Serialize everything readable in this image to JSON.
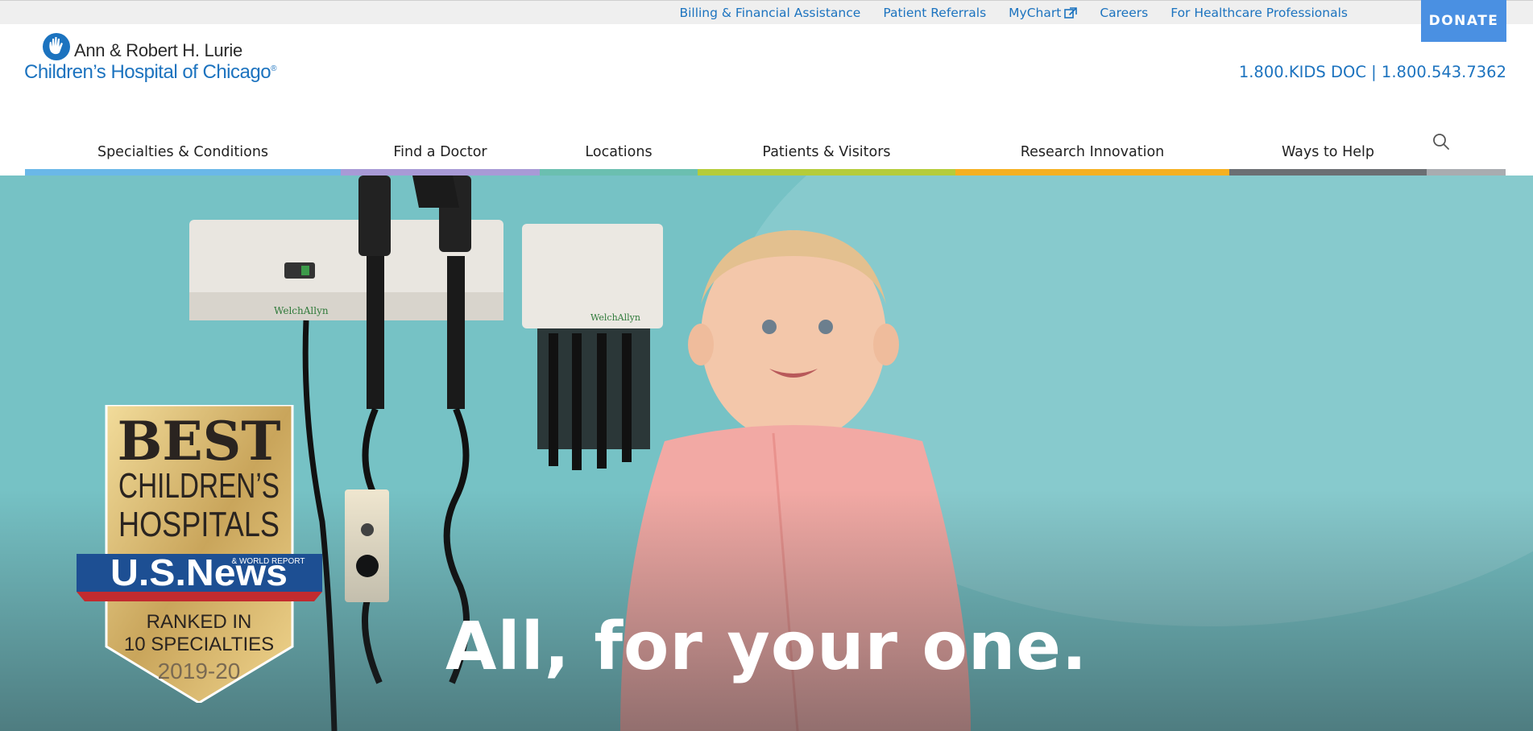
{
  "utility_nav": {
    "links": [
      {
        "label": "Billing & Financial Assistance"
      },
      {
        "label": "Patient Referrals"
      },
      {
        "label": "MyChart",
        "icon": "external-link-icon"
      },
      {
        "label": "Careers"
      },
      {
        "label": "For Healthcare Professionals"
      }
    ],
    "donate_label": "DONATE"
  },
  "logo": {
    "line1": "Ann & Robert H. Lurie",
    "line2": "Children’s Hospital of Chicago",
    "registered_mark": "®",
    "icon": "hand-heart-icon"
  },
  "header": {
    "phone": "1.800.KIDS DOC | 1.800.543.7362"
  },
  "main_nav": {
    "items": [
      {
        "label": "Specialties & Conditions",
        "color": "#6ab8e8"
      },
      {
        "label": "Find a Doctor",
        "color": "#a89ad6"
      },
      {
        "label": "Locations",
        "color": "#6bbfb0"
      },
      {
        "label": "Patients & Visitors",
        "color": "#b5cc3a"
      },
      {
        "label": "Research Innovation",
        "color": "#f5b021"
      },
      {
        "label": "Ways to Help",
        "color": "#6b6f73"
      }
    ],
    "search_icon": "search-icon",
    "search_bar_color": "#a9acb0"
  },
  "hero": {
    "headline": "All, for your one.",
    "badge": {
      "line1": "BEST",
      "line2": "CHILDREN’S",
      "line3": "HOSPITALS",
      "brand": "U.S.News",
      "brand_sub": "& WORLD REPORT",
      "line4": "RANKED IN",
      "line5": "10 SPECIALTIES",
      "year": "2019-20"
    },
    "equipment_brand": "WelchAllyn"
  },
  "colors": {
    "link_blue": "#1c73bf",
    "donate_blue": "#4a90e2",
    "hero_teal": "#74c1c4"
  }
}
